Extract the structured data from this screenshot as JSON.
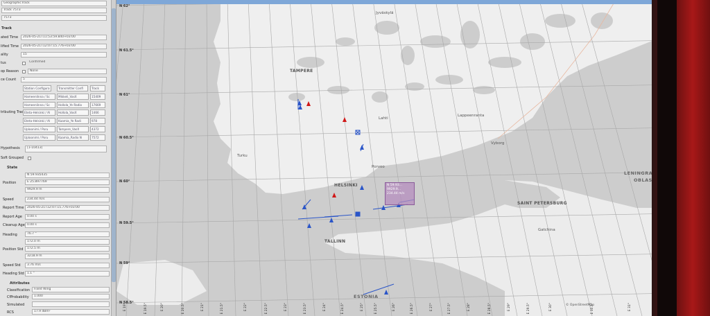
{
  "panel": {
    "title_field": "GeographicTrack",
    "name_field": "Track 7573",
    "id_field": "7573",
    "section_track": "Track",
    "created_time_label": "ated Time",
    "created_time": "2026-05-21T11:53:59.840+03:00",
    "modified_time_label": "lified Time",
    "modified_time": "2026-05-21T12:07:15.776+03:00",
    "quality_label": "ality",
    "quality": "15",
    "status_label": "tus",
    "status": "Confirmed",
    "drop_reason_label": "op Reason",
    "drop_reason": "None",
    "source_count_label": "ce Count",
    "source_count": "5",
    "table_headers": [
      "Station Configura",
      "Transmitter Confi",
      "Track"
    ],
    "table_rows": [
      [
        "Hameenlinna / Sc",
        "Mikkeli_VasX",
        "15409"
      ],
      [
        "Hameenlinna / Sc",
        "Hollola_Ye Radio",
        "17669"
      ],
      [
        "Eteta-Helsinki / Al",
        "Hollola_VasX",
        "1466"
      ],
      [
        "Eteta-Helsinki / Al",
        "Kaamia_Ye Radi",
        "978"
      ],
      [
        "Uploonimi / Poru",
        "Tampere_VasX",
        "4372"
      ],
      [
        "Uploonimi / Poru",
        "Kaamia_Radio N",
        "7572"
      ]
    ],
    "contributing_label": "tributing Tracks",
    "hypothesis_label": "Hypothesis",
    "hypothesis": "[1-10413]",
    "soft_grouped_label": "Soft Grouped",
    "section_state": "State",
    "position_label": "Position",
    "position_lat": "N 59.935435",
    "position_lon": "E 25.897769",
    "position_alt": "9929.9 m",
    "speed_label": "Speed",
    "speed": "234.44 m/s",
    "report_time_label": "Report Time",
    "report_time": "2026-05-21T12:07:15.776+03:00",
    "report_age_label": "Report Age",
    "report_age": "0.00 s",
    "cleanup_age_label": "Cleanup Age",
    "cleanup_age": "0.00 s",
    "heading_label": "Heading",
    "heading": "76.7 °",
    "heading_2": "172.0 m",
    "position_std_label": "Position Std",
    "position_std_1": "172.5 m",
    "position_std_2": "3218.9 m",
    "speed_std_label": "Speed Std",
    "speed_std": "3.76 m/s",
    "heading_std_label": "Heading Std",
    "heading_std": "1.1 °",
    "section_attributes": "Attributes",
    "classification_label": "Classification",
    "classification": "Fixed Wing",
    "cf_probability_label": "CfProbability",
    "cf_probability": "1.000",
    "simulated_label": "Simulated",
    "rcs_label": "RCS",
    "rcs": "17.9 dBm²"
  },
  "map": {
    "lat_labels": [
      "N 62°",
      "N 61.5°",
      "N 61°",
      "N 60.5°",
      "N 60°",
      "N 59.5°",
      "N 59°",
      "N 58.5°"
    ],
    "lon_labels": [
      "E 19°",
      "E 19.5°",
      "E 20°",
      "E 20.5°",
      "E 21°",
      "E 21.5°",
      "E 22°",
      "E 22.5°",
      "E 23°",
      "E 23.5°",
      "E 24°",
      "E 24.5°",
      "E 25°",
      "E 25.5°",
      "E 26°",
      "E 26.5°",
      "E 27°",
      "E 27.5°",
      "E 28°",
      "E 28.5°",
      "E 29°",
      "E 29.5°",
      "E 30°",
      "E 30.5°",
      "E 31°"
    ],
    "cities": {
      "tampere": "TAMPERE",
      "jyvaskyla": "Jyväskylä",
      "lappeenranta": "Lappeenranta",
      "lahti": "Lahti",
      "vyborg": "Vyborg",
      "turku": "Turku",
      "porvoo": "Porvoo",
      "helsinki": "HELSINKI",
      "saint_petersburg": "SAINT PETERSBURG",
      "gatchina": "Gatchina",
      "tallinn": "TALLINN",
      "estonia": "ESTONIA",
      "leningrad_1": "LENINGRAD",
      "leningrad_2": "OBLAST"
    },
    "info_box": [
      "N 59.93...",
      "9929.9...",
      "234.44 m/s"
    ],
    "attribution": "© OpenStreetMap",
    "window_controls": "▴ ▣ ✕",
    "colors": {
      "track": "#2a55c8",
      "hostile": "#d01818",
      "land": "#efefef",
      "sea": "#cdcdcd"
    }
  }
}
